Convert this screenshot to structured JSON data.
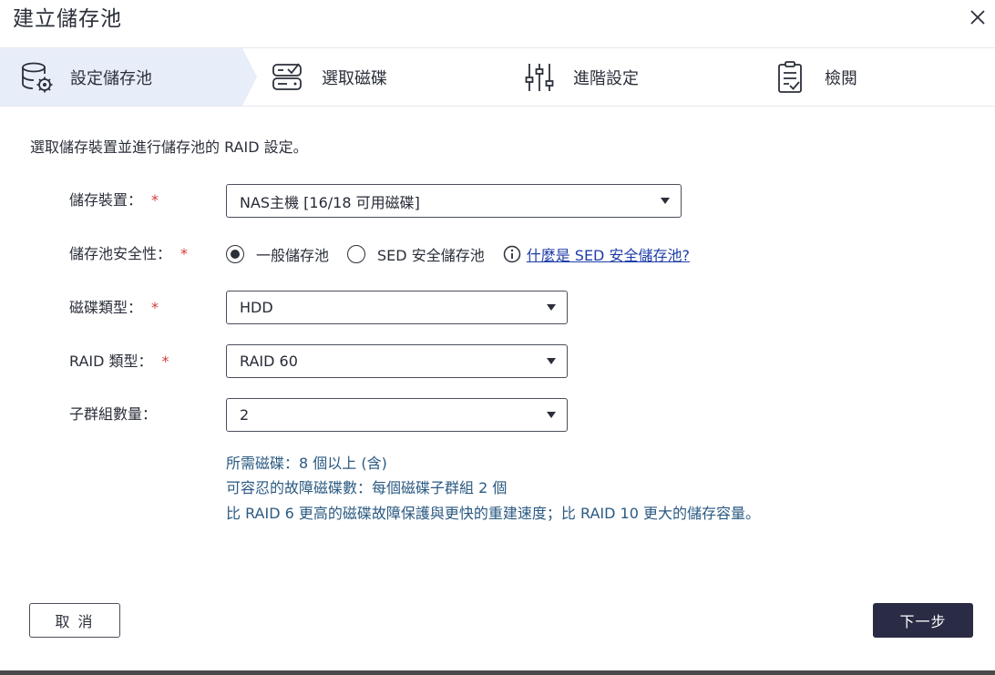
{
  "dialog": {
    "title": "建立儲存池",
    "close_icon": "close-icon"
  },
  "steps": [
    {
      "label": "設定儲存池",
      "icon": "storage-gear-icon",
      "active": true
    },
    {
      "label": "選取磁碟",
      "icon": "disk-select-icon",
      "active": false
    },
    {
      "label": "進階設定",
      "icon": "sliders-icon",
      "active": false
    },
    {
      "label": "檢閱",
      "icon": "checklist-icon",
      "active": false
    }
  ],
  "intro": "選取儲存裝置並進行儲存池的 RAID 設定。",
  "form": {
    "storage_device": {
      "label": "儲存裝置：",
      "required": "*",
      "value": "NAS主機 [16/18 可用磁碟]"
    },
    "pool_security": {
      "label": "儲存池安全性：",
      "required": "*",
      "options": [
        "一般儲存池",
        "SED 安全儲存池"
      ],
      "selected_index": 0,
      "help_link": "什麼是 SED 安全儲存池?"
    },
    "disk_type": {
      "label": "磁碟類型：",
      "required": "*",
      "value": "HDD"
    },
    "raid_type": {
      "label": "RAID 類型：",
      "required": "*",
      "value": "RAID 60"
    },
    "subgroups": {
      "label": "子群組數量：",
      "value": "2"
    }
  },
  "info": {
    "line1": "所需磁碟：8 個以上 (含)",
    "line2": "可容忍的故障磁碟數：每個磁碟子群組 2 個",
    "line3": "比 RAID 6 更高的磁碟故障保護與更快的重建速度；比 RAID 10 更大的儲存容量。"
  },
  "footer": {
    "cancel": "取 消",
    "next": "下一步"
  },
  "colors": {
    "active_step_bg": "#e7edf9",
    "required": "#d33b3b",
    "link": "#1f3ea8",
    "info_text": "#2b5a82",
    "primary_button": "#2a2b44"
  }
}
